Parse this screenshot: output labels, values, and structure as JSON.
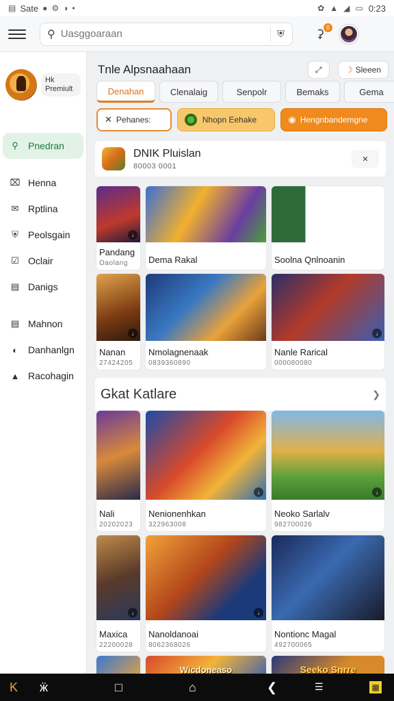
{
  "status_bar": {
    "left_text": "Sate",
    "time": "0:23"
  },
  "top_bar": {
    "search_placeholder": "Uasggoaraan",
    "notification_count": "0"
  },
  "sidebar": {
    "profile_label": "Hk Premiult",
    "items": [
      {
        "label": "Pnedran",
        "icon": "search-icon",
        "active": true
      },
      {
        "label": "Henna",
        "icon": "crossed-box-icon"
      },
      {
        "label": "Rptlina",
        "icon": "envelope-icon"
      },
      {
        "label": "Peolsgain",
        "icon": "shield-outline-icon"
      },
      {
        "label": "Oclair",
        "icon": "checkbox-icon"
      },
      {
        "label": "Danigs",
        "icon": "document-icon"
      },
      {
        "label": "Mahnon",
        "icon": "list-icon"
      },
      {
        "label": "Danhanlgn",
        "icon": "globe-icon"
      },
      {
        "label": "Racohagin",
        "icon": "person-icon"
      }
    ]
  },
  "main": {
    "section_title": "Tnle Alpsnaahaan",
    "sleep_button": "Sleeen",
    "tabs": [
      {
        "label": "Denahan",
        "active": true
      },
      {
        "label": "Clenalaig"
      },
      {
        "label": "Senpolr"
      },
      {
        "label": "Bemaks"
      },
      {
        "label": "Gema"
      }
    ],
    "chips": [
      {
        "label": "Pehanes:"
      },
      {
        "label": "Nhopn Eehake"
      },
      {
        "label": "Hengnbandemgne"
      }
    ],
    "featured": {
      "name": "DNIK Pluislan",
      "subtitle": "80003 0001",
      "close_label": "✕"
    },
    "games_row1": [
      {
        "name": "Pandang",
        "sub": "Oaolang"
      },
      {
        "name": "Dema Rakal",
        "sub": ""
      },
      {
        "name": "Soolna Qnlnoanin",
        "sub": ""
      }
    ],
    "games_row2": [
      {
        "name": "Nanan",
        "sub": "27424205"
      },
      {
        "name": "Nmolagnenaak",
        "sub": "0839360890"
      },
      {
        "name": "Nanle Rarical",
        "sub": "000080080"
      }
    ],
    "section2_title": "Gkat Katlare",
    "games_row3": [
      {
        "name": "Nali",
        "sub": "20202023"
      },
      {
        "name": "Nenionenhkan",
        "sub": "322963008"
      },
      {
        "name": "Neoko Sarlalv",
        "sub": "982700026"
      }
    ],
    "games_row4": [
      {
        "name": "Maxica",
        "sub": "22200028"
      },
      {
        "name": "Nanoldanoai",
        "sub": "8062368026"
      },
      {
        "name": "Nontionc Magal",
        "sub": "492700065"
      }
    ],
    "row5_banners": [
      "Wicdoneaso",
      "Seeko Snrre"
    ]
  }
}
